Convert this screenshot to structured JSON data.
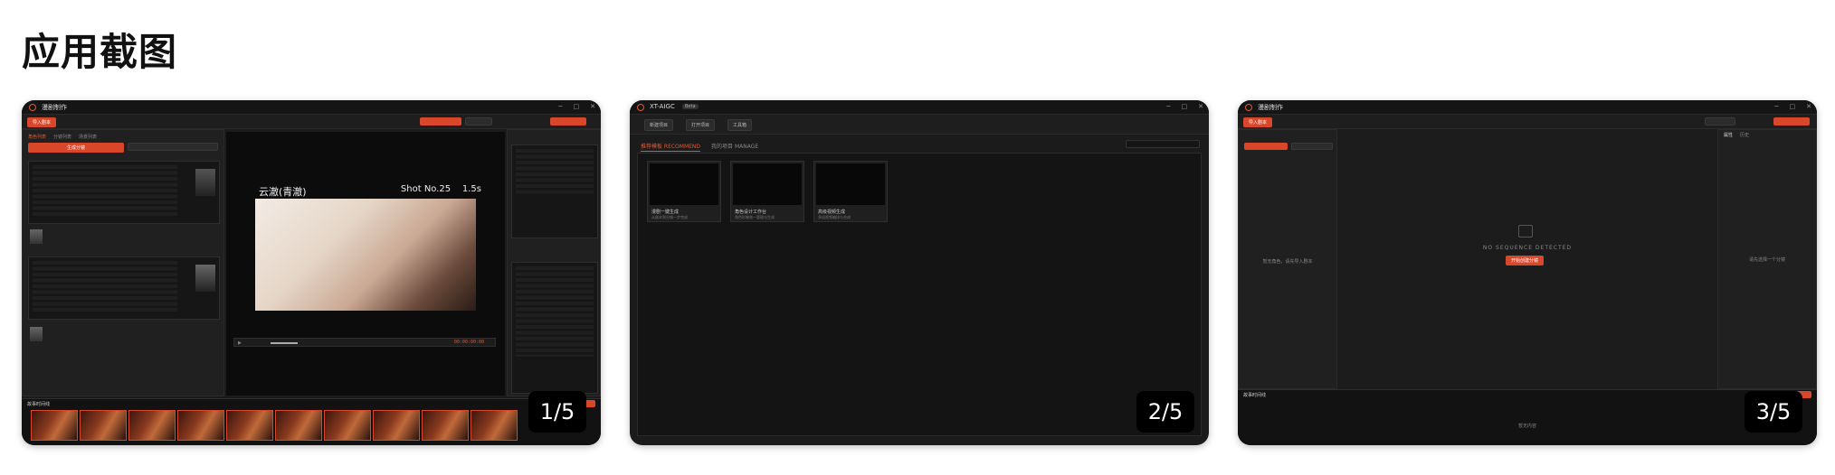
{
  "section": {
    "title": "应用截图"
  },
  "cards": [
    {
      "badge": "1/5",
      "app": {
        "title": "漫剧制作",
        "import_button": "导入剧本",
        "left_tabs": [
          "角色列表",
          "分镜列表",
          "场景列表"
        ],
        "generate_button": "生成分镜",
        "shot_title": "云澈(青澈)",
        "shot_no": "Shot No.25",
        "duration": "1.5s",
        "timecode": "00:00:00:00",
        "timeline_label": "故事时间线"
      }
    },
    {
      "badge": "2/5",
      "app": {
        "title": "XT-AIGC",
        "tag": "Beta",
        "buttons": [
          "新建项目",
          "打开项目",
          "工具箱"
        ],
        "tab_recommend": "推荐模板 RECOMMEND",
        "tab_manage": "我的项目 MANAGE",
        "templates": [
          {
            "name": "漫剧一键生成",
            "desc": "从剧本到分镜一步完成"
          },
          {
            "name": "角色设计工作台",
            "desc": "角色形象统一管理与生成"
          },
          {
            "name": "高级视频生成",
            "desc": "多段视频编排与合成"
          }
        ]
      }
    },
    {
      "badge": "3/5",
      "app": {
        "title": "漫剧制作",
        "import_button": "导入剧本",
        "panel_tabs": [
          "属性",
          "历史"
        ],
        "empty_title": "NO SEQUENCE DETECTED",
        "empty_button": "开始创建分镜",
        "left_empty": "暂无角色，请先导入剧本",
        "right_empty": "请先选择一个分镜",
        "timeline_label": "故事时间线",
        "timeline_empty": "暂无内容"
      }
    }
  ]
}
